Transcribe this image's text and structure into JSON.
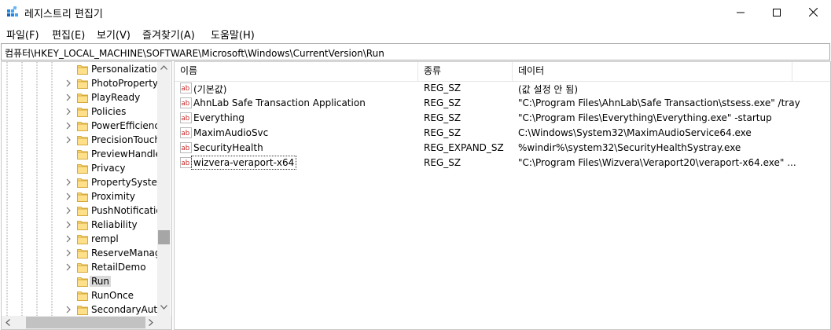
{
  "window": {
    "title": "레지스트리 편집기"
  },
  "menu": [
    {
      "label": "파일(F)"
    },
    {
      "label": "편집(E)"
    },
    {
      "label": "보기(V)"
    },
    {
      "label": "즐겨찾기(A)"
    },
    {
      "label": "도움말(H)"
    }
  ],
  "address": "컴퓨터\\HKEY_LOCAL_MACHINE\\SOFTWARE\\Microsoft\\Windows\\CurrentVersion\\Run",
  "tree": [
    {
      "label": "Personalization",
      "expandable": false
    },
    {
      "label": "PhotoPropertyHandler",
      "expandable": true
    },
    {
      "label": "PlayReady",
      "expandable": true
    },
    {
      "label": "Policies",
      "expandable": true
    },
    {
      "label": "PowerEfficiencyDiagnostics",
      "expandable": true
    },
    {
      "label": "PrecisionTouchPad",
      "expandable": true
    },
    {
      "label": "PreviewHandlers",
      "expandable": false
    },
    {
      "label": "Privacy",
      "expandable": false
    },
    {
      "label": "PropertySystem",
      "expandable": true
    },
    {
      "label": "Proximity",
      "expandable": true
    },
    {
      "label": "PushNotifications",
      "expandable": true
    },
    {
      "label": "Reliability",
      "expandable": true
    },
    {
      "label": "rempl",
      "expandable": true
    },
    {
      "label": "ReserveManager",
      "expandable": true
    },
    {
      "label": "RetailDemo",
      "expandable": true
    },
    {
      "label": "Run",
      "expandable": false,
      "selected": true
    },
    {
      "label": "RunOnce",
      "expandable": false
    },
    {
      "label": "SecondaryAuthFactor",
      "expandable": true
    }
  ],
  "columns": {
    "name": "이름",
    "type": "종류",
    "data": "데이터"
  },
  "values": [
    {
      "name": "(기본값)",
      "type": "REG_SZ",
      "data": "(값 설정 안 됨)"
    },
    {
      "name": "AhnLab Safe Transaction Application",
      "type": "REG_SZ",
      "data": "\"C:\\Program Files\\AhnLab\\Safe Transaction\\stsess.exe\" /tray"
    },
    {
      "name": "Everything",
      "type": "REG_SZ",
      "data": "\"C:\\Program Files\\Everything\\Everything.exe\" -startup"
    },
    {
      "name": "MaximAudioSvc",
      "type": "REG_SZ",
      "data": "C:\\Windows\\System32\\MaximAudioService64.exe"
    },
    {
      "name": "SecurityHealth",
      "type": "REG_EXPAND_SZ",
      "data": "%windir%\\system32\\SecurityHealthSystray.exe"
    },
    {
      "name": "wizvera-veraport-x64",
      "type": "REG_SZ",
      "data": "\"C:\\Program Files\\Wizvera\\Veraport20\\veraport-x64.exe\" ...",
      "focused": true
    }
  ]
}
